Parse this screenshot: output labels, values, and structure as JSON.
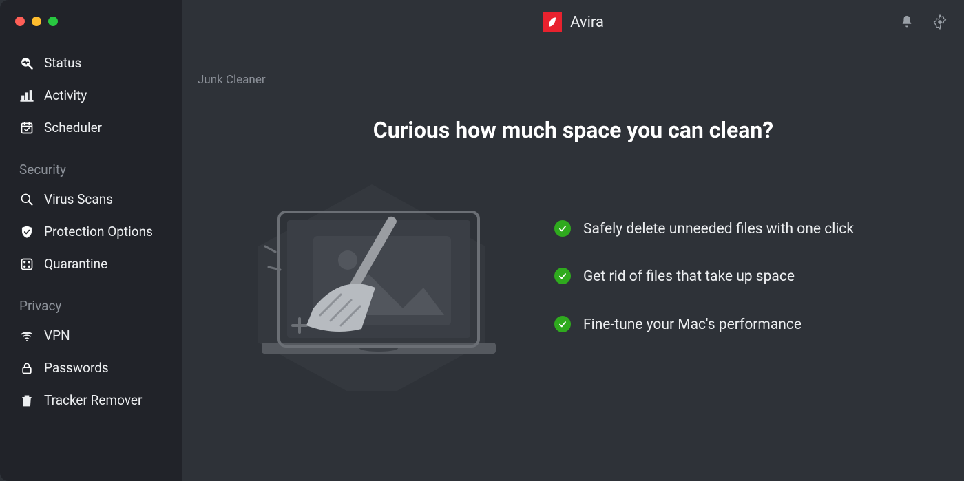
{
  "brand": {
    "name": "Avira"
  },
  "breadcrumb": "Junk Cleaner",
  "headline": "Curious how much space you can clean?",
  "benefits": [
    "Safely delete unneeded files with one click",
    "Get rid of files that take up space",
    "Fine-tune your Mac's performance"
  ],
  "sidebar": {
    "top": [
      {
        "id": "status",
        "label": "Status"
      },
      {
        "id": "activity",
        "label": "Activity"
      },
      {
        "id": "scheduler",
        "label": "Scheduler"
      }
    ],
    "sections": [
      {
        "title": "Security",
        "items": [
          {
            "id": "virus-scans",
            "label": "Virus Scans"
          },
          {
            "id": "protection-options",
            "label": "Protection Options"
          },
          {
            "id": "quarantine",
            "label": "Quarantine"
          }
        ]
      },
      {
        "title": "Privacy",
        "items": [
          {
            "id": "vpn",
            "label": "VPN"
          },
          {
            "id": "passwords",
            "label": "Passwords"
          },
          {
            "id": "tracker-remover",
            "label": "Tracker Remover"
          }
        ]
      }
    ]
  },
  "colors": {
    "accent_green": "#2faa1e",
    "brand_red": "#e8222e"
  }
}
